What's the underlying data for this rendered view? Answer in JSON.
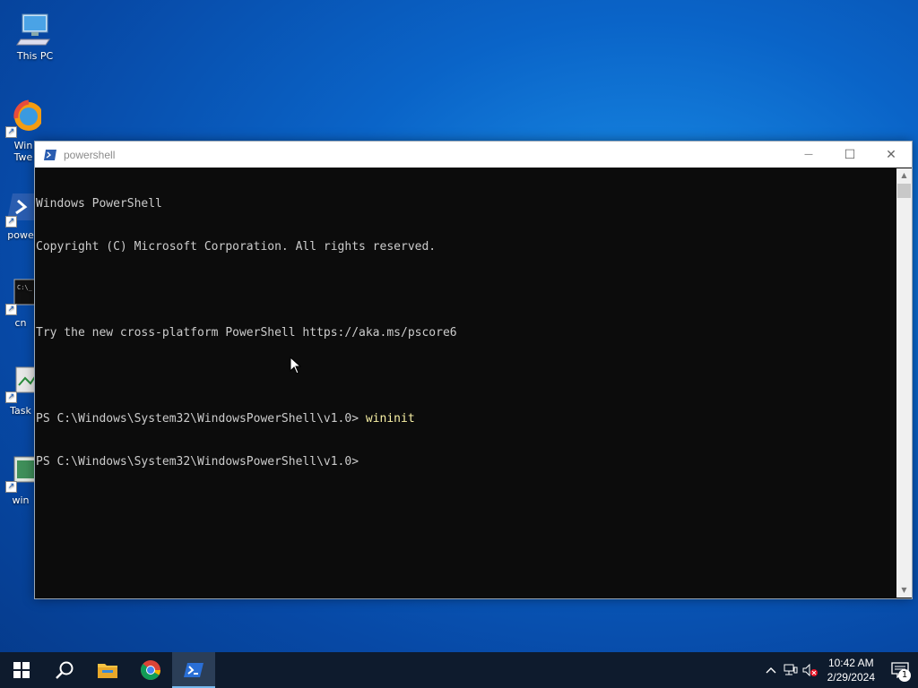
{
  "desktop": {
    "icons": [
      {
        "label": "This PC"
      },
      {
        "label": "Win\nTwe"
      },
      {
        "label": "powe"
      },
      {
        "label": "cn"
      },
      {
        "label": "Task"
      },
      {
        "label": "win"
      }
    ]
  },
  "window": {
    "title": "powershell",
    "minimize": "—",
    "maximize": "☐",
    "close": "✕"
  },
  "console": {
    "lines": [
      "Windows PowerShell",
      "Copyright (C) Microsoft Corporation. All rights reserved.",
      "",
      "Try the new cross-platform PowerShell https://aka.ms/pscore6",
      "",
      "PS C:\\Windows\\System32\\WindowsPowerShell\\v1.0> ",
      "PS C:\\Windows\\System32\\WindowsPowerShell\\v1.0>"
    ],
    "command": "wininit"
  },
  "taskbar": {
    "items": [
      {
        "icon": "windows-start-icon"
      },
      {
        "icon": "search-icon"
      },
      {
        "icon": "file-explorer-icon"
      },
      {
        "icon": "chrome-icon"
      },
      {
        "icon": "powershell-icon",
        "active": true
      }
    ],
    "tray": {
      "chevron": "^",
      "time": "10:42 AM",
      "date": "2/29/2024",
      "notification_count": "1"
    }
  },
  "colors": {
    "console_bg": "#0c0c0c",
    "console_text": "#cccccc",
    "command_text": "#f9f1a5",
    "taskbar_bg": "#0e1b2d",
    "accent": "#76b9ed"
  }
}
